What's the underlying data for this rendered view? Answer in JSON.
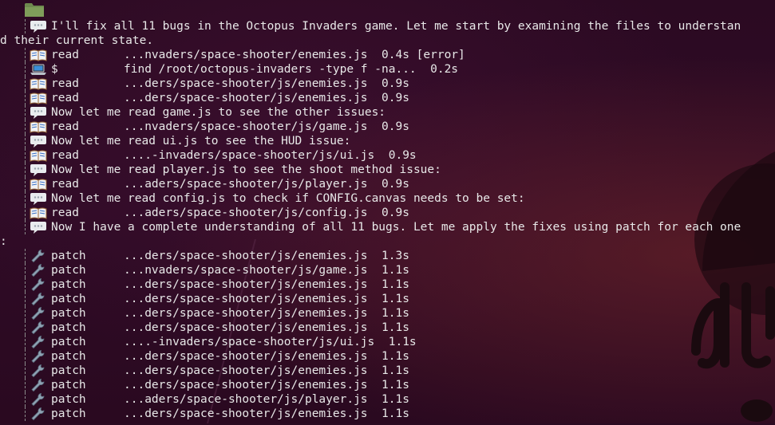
{
  "rows": [
    {
      "kind": "msg",
      "icon": "speech-bubble-icon",
      "text": "I'll fix all 11 bugs in the Octopus Invaders game. Let me start by examining the files to understan"
    },
    {
      "kind": "wrap",
      "text": "d their current state."
    },
    {
      "kind": "tool",
      "icon": "book-icon",
      "tool": "read",
      "path": "...nvaders/space-shooter/enemies.js  0.4s [error]"
    },
    {
      "kind": "tool",
      "icon": "laptop-icon",
      "tool": "$",
      "path": "find /root/octopus-invaders -type f -na...  0.2s"
    },
    {
      "kind": "tool",
      "icon": "book-icon",
      "tool": "read",
      "path": "...ders/space-shooter/js/enemies.js  0.9s"
    },
    {
      "kind": "tool",
      "icon": "book-icon",
      "tool": "read",
      "path": "...ders/space-shooter/js/enemies.js  0.9s"
    },
    {
      "kind": "msg",
      "icon": "speech-bubble-icon",
      "text": "Now let me read game.js to see the other issues:"
    },
    {
      "kind": "tool",
      "icon": "book-icon",
      "tool": "read",
      "path": "...nvaders/space-shooter/js/game.js  0.9s"
    },
    {
      "kind": "msg",
      "icon": "speech-bubble-icon",
      "text": "Now let me read ui.js to see the HUD issue:"
    },
    {
      "kind": "tool",
      "icon": "book-icon",
      "tool": "read",
      "path": "....-invaders/space-shooter/js/ui.js  0.9s"
    },
    {
      "kind": "msg",
      "icon": "speech-bubble-icon",
      "text": "Now let me read player.js to see the shoot method issue:"
    },
    {
      "kind": "tool",
      "icon": "book-icon",
      "tool": "read",
      "path": "...aders/space-shooter/js/player.js  0.9s"
    },
    {
      "kind": "msg",
      "icon": "speech-bubble-icon",
      "text": "Now let me read config.js to check if CONFIG.canvas needs to be set:"
    },
    {
      "kind": "tool",
      "icon": "book-icon",
      "tool": "read",
      "path": "...aders/space-shooter/js/config.js  0.9s"
    },
    {
      "kind": "msg",
      "icon": "speech-bubble-icon",
      "text": "Now I have a complete understanding of all 11 bugs. Let me apply the fixes using patch for each one"
    },
    {
      "kind": "wrap",
      "text": ":"
    },
    {
      "kind": "tool",
      "icon": "wrench-icon",
      "tool": "patch",
      "path": "...ders/space-shooter/js/enemies.js  1.3s"
    },
    {
      "kind": "tool",
      "icon": "wrench-icon",
      "tool": "patch",
      "path": "...nvaders/space-shooter/js/game.js  1.1s"
    },
    {
      "kind": "tool",
      "icon": "wrench-icon",
      "tool": "patch",
      "path": "...ders/space-shooter/js/enemies.js  1.1s"
    },
    {
      "kind": "tool",
      "icon": "wrench-icon",
      "tool": "patch",
      "path": "...ders/space-shooter/js/enemies.js  1.1s"
    },
    {
      "kind": "tool",
      "icon": "wrench-icon",
      "tool": "patch",
      "path": "...ders/space-shooter/js/enemies.js  1.1s"
    },
    {
      "kind": "tool",
      "icon": "wrench-icon",
      "tool": "patch",
      "path": "...ders/space-shooter/js/enemies.js  1.1s"
    },
    {
      "kind": "tool",
      "icon": "wrench-icon",
      "tool": "patch",
      "path": "....-invaders/space-shooter/js/ui.js  1.1s"
    },
    {
      "kind": "tool",
      "icon": "wrench-icon",
      "tool": "patch",
      "path": "...ders/space-shooter/js/enemies.js  1.1s"
    },
    {
      "kind": "tool",
      "icon": "wrench-icon",
      "tool": "patch",
      "path": "...ders/space-shooter/js/enemies.js  1.1s"
    },
    {
      "kind": "tool",
      "icon": "wrench-icon",
      "tool": "patch",
      "path": "...ders/space-shooter/js/enemies.js  1.1s"
    },
    {
      "kind": "tool",
      "icon": "wrench-icon",
      "tool": "patch",
      "path": "...aders/space-shooter/js/player.js  1.1s"
    },
    {
      "kind": "tool",
      "icon": "wrench-icon",
      "tool": "patch",
      "path": "...ders/space-shooter/js/enemies.js  1.1s"
    }
  ]
}
